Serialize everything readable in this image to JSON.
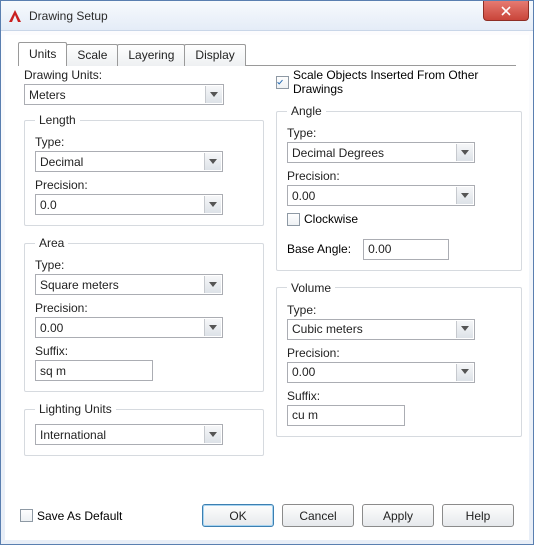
{
  "window": {
    "title": "Drawing Setup"
  },
  "tabs": {
    "items": [
      "Units",
      "Scale",
      "Layering",
      "Display"
    ],
    "active_index": 0
  },
  "drawing_units": {
    "label": "Drawing Units:",
    "value": "Meters"
  },
  "scale_checkbox": {
    "label": "Scale Objects Inserted From Other Drawings",
    "checked": true
  },
  "length": {
    "legend": "Length",
    "type_label": "Type:",
    "type_value": "Decimal",
    "precision_label": "Precision:",
    "precision_value": "0.0"
  },
  "area": {
    "legend": "Area",
    "type_label": "Type:",
    "type_value": "Square meters",
    "precision_label": "Precision:",
    "precision_value": "0.00",
    "suffix_label": "Suffix:",
    "suffix_value": "sq m"
  },
  "lighting": {
    "legend": "Lighting Units",
    "value": "International"
  },
  "angle": {
    "legend": "Angle",
    "type_label": "Type:",
    "type_value": "Decimal Degrees",
    "precision_label": "Precision:",
    "precision_value": "0.00",
    "clockwise_label": "Clockwise",
    "clockwise_checked": false,
    "base_angle_label": "Base Angle:",
    "base_angle_value": "0.00"
  },
  "volume": {
    "legend": "Volume",
    "type_label": "Type:",
    "type_value": "Cubic meters",
    "precision_label": "Precision:",
    "precision_value": "0.00",
    "suffix_label": "Suffix:",
    "suffix_value": "cu m"
  },
  "save_default": {
    "label": "Save As Default",
    "checked": false
  },
  "buttons": {
    "ok": "OK",
    "cancel": "Cancel",
    "apply": "Apply",
    "help": "Help"
  }
}
